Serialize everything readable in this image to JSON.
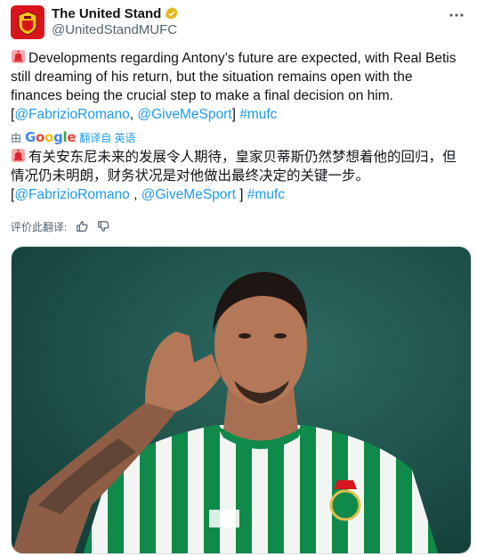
{
  "tweet": {
    "display_name": "The United Stand",
    "handle": "@UnitedStandMUFC",
    "text_main": "Developments regarding Antony’s future are expected, with Real Betis still dreaming of his return, but the situation remains open with the finances being the crucial step to make a final decision on him. [",
    "mention1": "@FabrizioRomano",
    "sep": ", ",
    "mention2": "@GiveMeSport",
    "close": "] ",
    "hashtag": "#mufc"
  },
  "translation": {
    "by": "由",
    "google_g": "G",
    "google_o1": "o",
    "google_o2": "o",
    "google_g2": "g",
    "google_l": "l",
    "google_e": "e",
    "translated_label": "翻译自 英语",
    "text_main": "有关安东尼未来的发展令人期待，皇家贝蒂斯仍然梦想着他的回归，但情况仍未明朗，财务状况是对他做出最终决定的关键一步。[",
    "mention1": "@FabrizioRomano",
    "sep": " , ",
    "mention2": "@GiveMeSport",
    "close": " ] ",
    "hashtag": "#mufc"
  },
  "rating": {
    "label": "评价此翻译:"
  },
  "colors": {
    "link": "#1d9bf0",
    "verified": "#e2b719",
    "photo_bg": "#1e4b45",
    "kit_green": "#0f8a4a"
  },
  "icons": [
    "siren-icon",
    "verified-badge-icon",
    "more-options-icon",
    "thumbs-up-icon",
    "thumbs-down-icon"
  ]
}
